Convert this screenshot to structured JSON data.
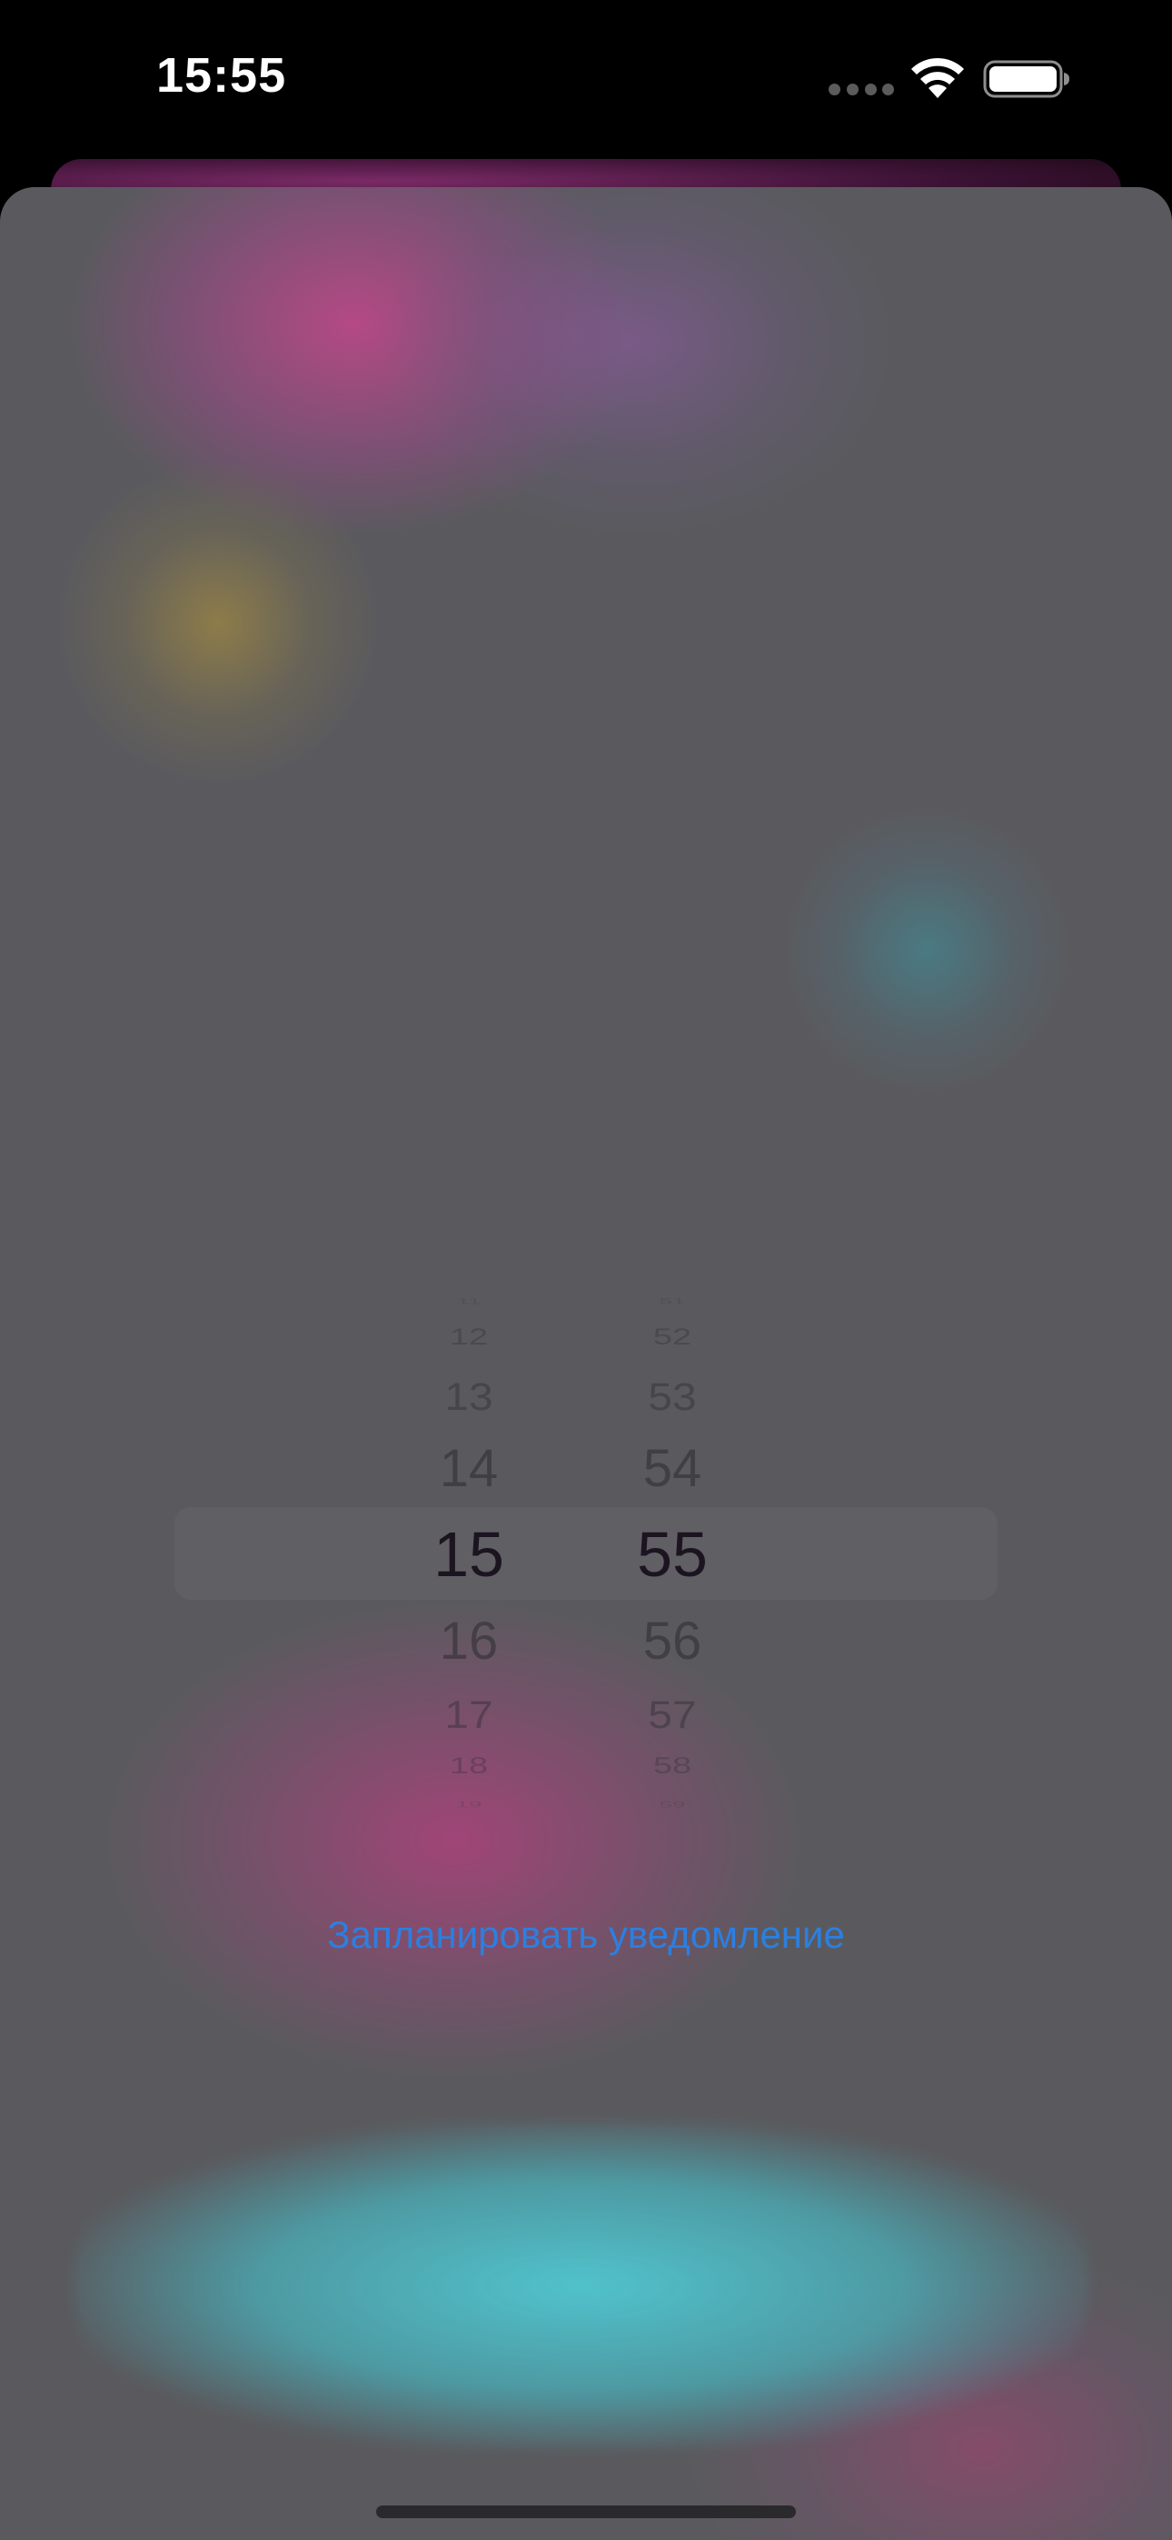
{
  "status_bar": {
    "time": "15:55",
    "cellular_icon": "cellular-signal-dots-icon",
    "wifi_icon": "wifi-icon",
    "battery_icon": "battery-full-icon"
  },
  "time_picker": {
    "hours": {
      "above": [
        "11",
        "12",
        "13",
        "14"
      ],
      "selected": "15",
      "below": [
        "16",
        "17",
        "18",
        "19"
      ]
    },
    "minutes": {
      "above": [
        "51",
        "52",
        "53",
        "54"
      ],
      "selected": "55",
      "below": [
        "56",
        "57",
        "58",
        "59"
      ]
    }
  },
  "actions": {
    "schedule_label": "Запланировать уведомление"
  },
  "colors": {
    "accent": "#2c7fe0",
    "sheet_background": "#5a5a5e",
    "selected_text": "#1c1420"
  }
}
